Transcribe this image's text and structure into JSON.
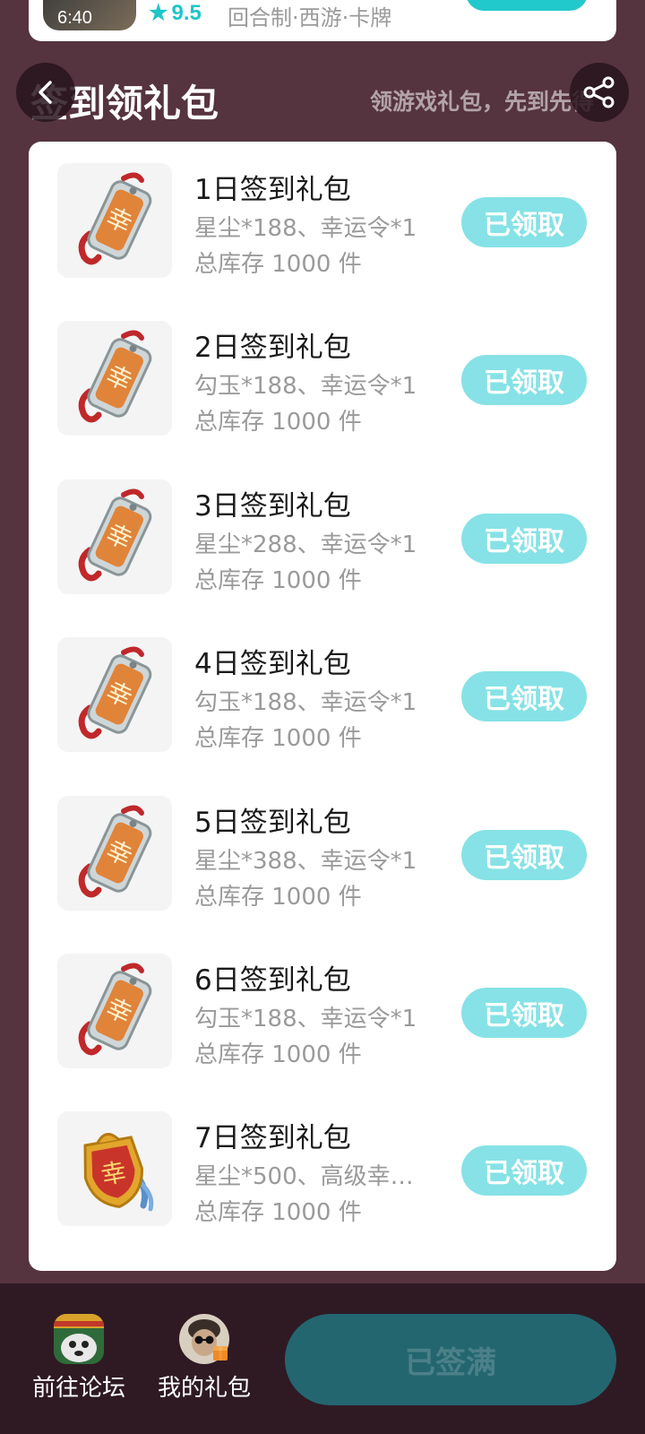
{
  "game": {
    "duration": "6:40",
    "score": "9.5",
    "tags": "回合制·西游·卡牌"
  },
  "header": {
    "title": "签到领礼包",
    "subtitle": "领游戏礼包，先到先得"
  },
  "gifts": [
    {
      "name": "1日签到礼包",
      "content": "星尘*188、幸运令*1",
      "stock": "总库存 1000 件",
      "button": "已领取"
    },
    {
      "name": "2日签到礼包",
      "content": "勾玉*188、幸运令*1",
      "stock": "总库存 1000 件",
      "button": "已领取"
    },
    {
      "name": "3日签到礼包",
      "content": "星尘*288、幸运令*1",
      "stock": "总库存 1000 件",
      "button": "已领取"
    },
    {
      "name": "4日签到礼包",
      "content": "勾玉*188、幸运令*1",
      "stock": "总库存 1000 件",
      "button": "已领取"
    },
    {
      "name": "5日签到礼包",
      "content": "星尘*388、幸运令*1",
      "stock": "总库存 1000 件",
      "button": "已领取"
    },
    {
      "name": "6日签到礼包",
      "content": "勾玉*188、幸运令*1",
      "stock": "总库存 1000 件",
      "button": "已领取"
    },
    {
      "name": "7日签到礼包",
      "content": "星尘*500、高级幸…",
      "stock": "总库存 1000 件",
      "button": "已领取"
    }
  ],
  "bottom": {
    "forum_label": "前往论坛",
    "my_gift_label": "我的礼包",
    "signed_label": "已签满"
  },
  "colors": {
    "background": "#55333f",
    "accent": "#22c9cc",
    "claimed_button": "#86e2e6",
    "bottom_bar": "#2f1a24",
    "signed_button": "#236670"
  },
  "icons": {
    "back": "chevron-left-icon",
    "share": "share-icon",
    "gift_tag": "lucky-tag-icon",
    "gift_tag_gold": "gold-lucky-tag-icon"
  }
}
